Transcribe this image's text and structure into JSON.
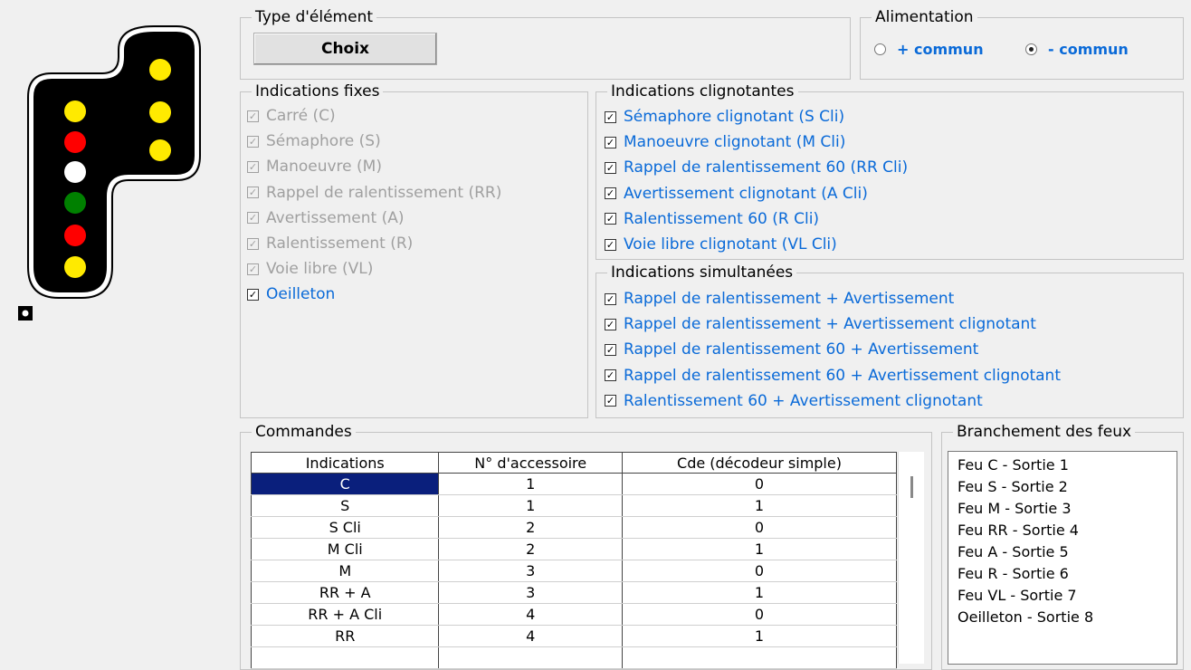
{
  "signal": {
    "colors": {
      "yellow": "#ffea00",
      "red": "#ff0000",
      "white": "#ffffff",
      "green": "#008000",
      "body": "#000000"
    }
  },
  "type_element": {
    "legend": "Type d'élément",
    "button": "Choix"
  },
  "alimentation": {
    "legend": "Alimentation",
    "options": [
      {
        "label": "+ commun",
        "selected": false
      },
      {
        "label": "- commun",
        "selected": true
      }
    ]
  },
  "fixes": {
    "legend": "Indications fixes",
    "items": [
      {
        "label": "Carré (C)",
        "checked": true,
        "enabled": false
      },
      {
        "label": "Sémaphore (S)",
        "checked": true,
        "enabled": false
      },
      {
        "label": "Manoeuvre (M)",
        "checked": true,
        "enabled": false
      },
      {
        "label": "Rappel de ralentissement (RR)",
        "checked": true,
        "enabled": false
      },
      {
        "label": "Avertissement (A)",
        "checked": true,
        "enabled": false
      },
      {
        "label": "Ralentissement (R)",
        "checked": true,
        "enabled": false
      },
      {
        "label": "Voie libre (VL)",
        "checked": true,
        "enabled": false
      },
      {
        "label": "Oeilleton",
        "checked": true,
        "enabled": true
      }
    ]
  },
  "clignotantes": {
    "legend": "Indications clignotantes",
    "items": [
      {
        "label": "Sémaphore clignotant (S Cli)",
        "checked": true
      },
      {
        "label": "Manoeuvre clignotant (M Cli)",
        "checked": true
      },
      {
        "label": "Rappel de ralentissement 60 (RR Cli)",
        "checked": true
      },
      {
        "label": "Avertissement clignotant (A Cli)",
        "checked": true
      },
      {
        "label": "Ralentissement 60 (R Cli)",
        "checked": true
      },
      {
        "label": "Voie libre clignotant (VL Cli)",
        "checked": true
      }
    ]
  },
  "simultanees": {
    "legend": "Indications simultanées",
    "items": [
      {
        "label": "Rappel de ralentissement + Avertissement",
        "checked": true
      },
      {
        "label": "Rappel de ralentissement + Avertissement clignotant",
        "checked": true
      },
      {
        "label": "Rappel de ralentissement 60 + Avertissement",
        "checked": true
      },
      {
        "label": "Rappel de ralentissement 60 + Avertissement clignotant",
        "checked": true
      },
      {
        "label": "Ralentissement 60 +  Avertissement clignotant",
        "checked": true
      }
    ]
  },
  "commandes": {
    "legend": "Commandes",
    "headers": [
      "Indications",
      "N° d'accessoire",
      "Cde (décodeur simple)"
    ],
    "rows": [
      [
        "C",
        "1",
        "0"
      ],
      [
        "S",
        "1",
        "1"
      ],
      [
        "S Cli",
        "2",
        "0"
      ],
      [
        "M Cli",
        "2",
        "1"
      ],
      [
        "M",
        "3",
        "0"
      ],
      [
        "RR + A",
        "3",
        "1"
      ],
      [
        "RR + A Cli",
        "4",
        "0"
      ],
      [
        "RR",
        "4",
        "1"
      ]
    ]
  },
  "branchement": {
    "legend": "Branchement des feux",
    "items": [
      "Feu C - Sortie 1",
      "Feu S - Sortie 2",
      "Feu M - Sortie 3",
      "Feu RR - Sortie 4",
      "Feu A - Sortie 5",
      "Feu R - Sortie 6",
      "Feu VL - Sortie 7",
      "Oeilleton - Sortie 8"
    ]
  }
}
